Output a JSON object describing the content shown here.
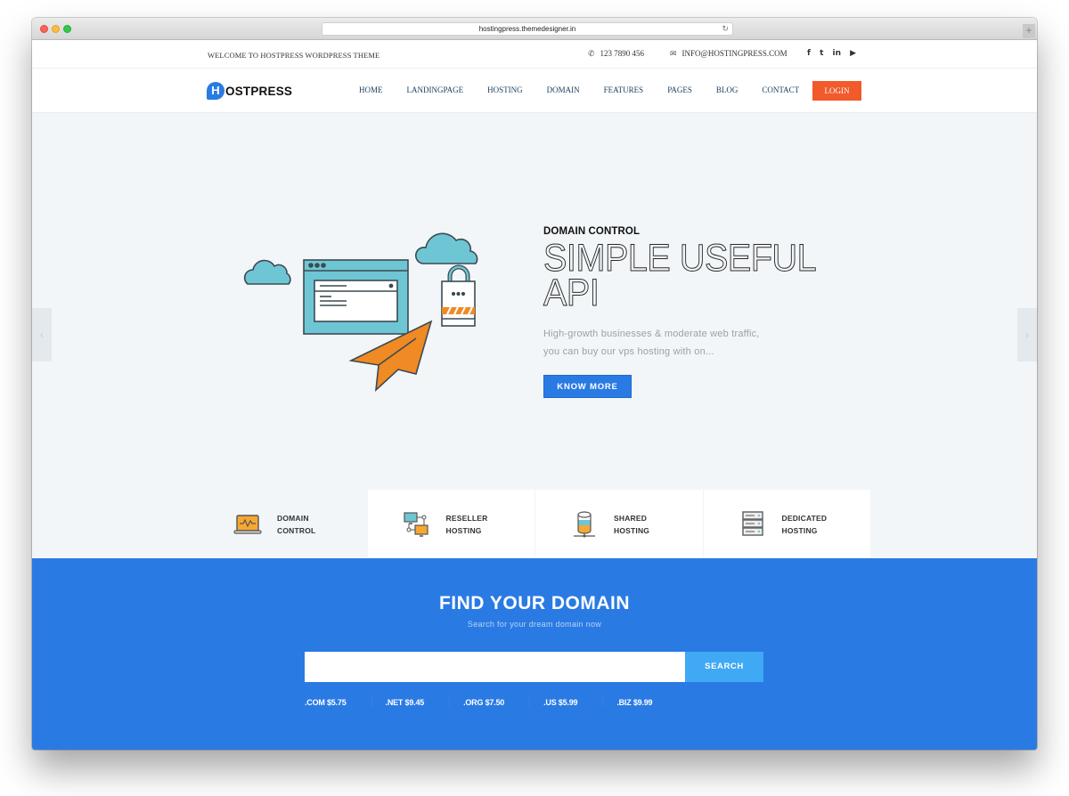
{
  "browser": {
    "url": "hostingpress.themedesigner.in",
    "reload_icon": "↻",
    "new_tab_icon": "+"
  },
  "topbar": {
    "welcome": "WELCOME TO HOSTPRESS WORDPRESS THEME",
    "phone_icon": "✆",
    "phone": "123 7890 456",
    "mail_icon": "✉",
    "email": "INFO@HOSTINGPRESS.COM",
    "socials": [
      {
        "name": "facebook-icon",
        "glyph": "f"
      },
      {
        "name": "twitter-icon",
        "glyph": "t"
      },
      {
        "name": "linkedin-icon",
        "glyph": "in"
      },
      {
        "name": "youtube-icon",
        "glyph": "▶"
      }
    ]
  },
  "navbar": {
    "logo_letter": "H",
    "logo_text": "OSTPRESS",
    "items": [
      "HOME",
      "LANDINGPAGE",
      "HOSTING",
      "DOMAIN",
      "FEATURES",
      "PAGES",
      "BLOG",
      "CONTACT"
    ],
    "login_label": "LOGIN"
  },
  "hero": {
    "eyebrow": "DOMAIN CONTROL",
    "headline_line1": "SIMPLE USEFUL",
    "headline_line2": "API",
    "description_line1": "High-growth businesses & moderate web traffic,",
    "description_line2": "you can buy our vps hosting with on...",
    "cta_label": "KNOW MORE",
    "prev_arrow": "‹",
    "next_arrow": "›"
  },
  "features": [
    {
      "line1": "DOMAIN",
      "line2": "CONTROL",
      "icon": "laptop-chart-icon",
      "active": true
    },
    {
      "line1": "RESELLER",
      "line2": "HOSTING",
      "icon": "network-monitors-icon",
      "active": false
    },
    {
      "line1": "SHARED",
      "line2": "HOSTING",
      "icon": "database-icon",
      "active": false
    },
    {
      "line1": "DEDICATED",
      "line2": "HOSTING",
      "icon": "server-rack-icon",
      "active": false
    }
  ],
  "domain_search": {
    "title": "FIND YOUR DOMAIN",
    "subtitle": "Search for your dream domain now",
    "input_value": "",
    "input_placeholder": "",
    "button_label": "SEARCH",
    "tlds": [
      ".COM $5.75",
      ".NET $9.45",
      ".ORG $7.50",
      ".US $5.99",
      ".BIZ $9.99"
    ]
  },
  "colors": {
    "brand_blue": "#2a7ae4",
    "login_orange": "#f15a2b",
    "search_button": "#3fa9f5",
    "illustration_teal": "#6ec6d4",
    "illustration_orange": "#f08a24"
  }
}
